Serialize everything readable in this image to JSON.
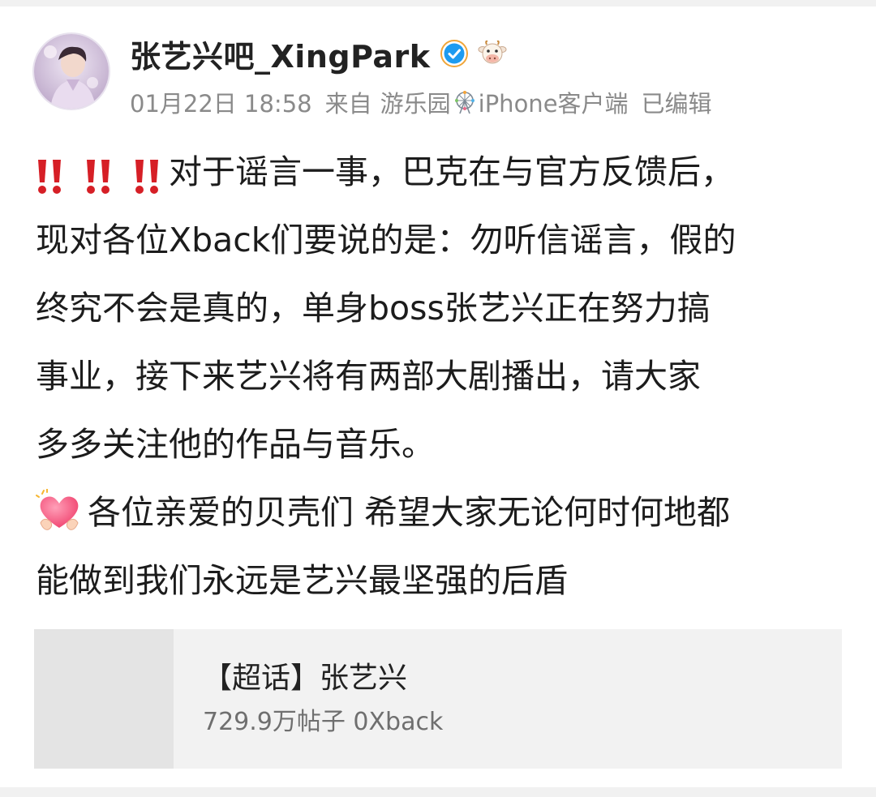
{
  "user": {
    "name": "张艺兴吧_XingPark",
    "avatar_icon": "avatar-portrait-icon",
    "verified_icon": "blue-verified-check-icon",
    "badge_icon": "cow-emoji-icon"
  },
  "meta": {
    "date": "01月22日 18:58",
    "from_label": "来自",
    "source_prefix": "游乐园",
    "source_icon": "ferris-wheel-icon",
    "source_suffix": "iPhone客户端",
    "edited": "已编辑"
  },
  "post": {
    "emoji_alert": "double-exclamation-icon",
    "line1": "对于谣言一事，巴克在与官方反馈后，",
    "line2": "现对各位Xback们要说的是：勿听信谣言，假的",
    "line3": "终究不会是真的，单身boss张艺兴正在努力搞",
    "line4": "事业，接下来艺兴将有两部大剧播出，请大家",
    "line5": "多多关注他的作品与音乐。",
    "emoji_heart": "heart-hands-icon",
    "line6": "各位亲爱的贝壳们 希望大家无论何时何地都",
    "line7": "能做到我们永远是艺兴最坚强的后盾"
  },
  "topic": {
    "title": "【超话】张艺兴",
    "stats": "729.9万帖子 0Xback"
  },
  "colors": {
    "verified": "#1d9bf0",
    "exclamation": "#d61f26",
    "meta_text": "#8a8a8a",
    "card_bg": "#f2f2f2"
  }
}
